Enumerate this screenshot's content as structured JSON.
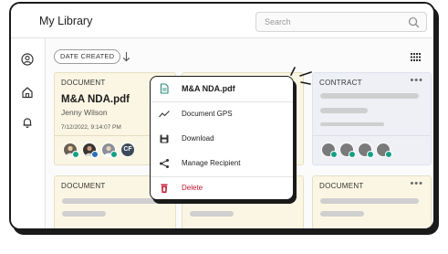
{
  "header": {
    "title": "My Library",
    "search_placeholder": "Search"
  },
  "toolbar": {
    "filter_label": "DATE CREATED"
  },
  "cards": [
    {
      "type_label": "DOCUMENT",
      "title": "M&A NDA.pdf",
      "owner": "Jenny Wilson",
      "date": "7/12/2022, 9:14:07 PM",
      "avatars": [
        "person",
        "person",
        "person",
        "CF"
      ]
    },
    {
      "type_label": "CONTRACT"
    },
    {
      "type_label": "DOCUMENT"
    },
    {
      "type_label": "DOCUMENT"
    }
  ],
  "context_menu": {
    "header": "M&A NDA.pdf",
    "items": [
      {
        "label": "Document GPS",
        "icon": "trend-icon"
      },
      {
        "label": "Download",
        "icon": "save-icon"
      },
      {
        "label": "Manage Recipient",
        "icon": "share-icon"
      },
      {
        "label": "Delete",
        "icon": "trash-icon",
        "color": "#c0152f"
      }
    ]
  },
  "colors": {
    "card_yellow": "#fbf6e3",
    "card_blue": "#eef0f6",
    "delete_red": "#c0152f",
    "badge_green": "#16a085"
  }
}
